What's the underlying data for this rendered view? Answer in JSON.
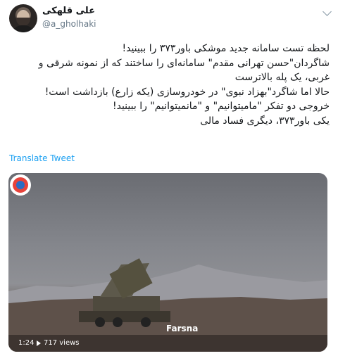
{
  "author": {
    "name": "علی قلهکی",
    "handle": "@a_gholhaki"
  },
  "tweet": {
    "lines": [
      "لحظه تست سامانه جدید موشکی باور۳۷۳ را ببینید!",
      "شاگردان\"حسن تهرانی مقدم\" سامانه‌ای را ساختند که از نمونه شرقی و",
      "غربی، یک پله بالاترست",
      "حالا اما شاگرد\"بهزاد نبوی\" در خودروسازی (یکه زارع) بازداشت است!",
      "خروجی دو تفکر \"ماميتوانيم\" و \"مانميتوانيم\" را ببينيد!",
      "یکی باور۳۷۳، دیگری فساد مالی"
    ],
    "translate_label": "Translate Tweet"
  },
  "media": {
    "watermark": "Farsna",
    "time": "1:24",
    "views": "717 views"
  },
  "icons": {
    "more": "chevron-down-icon",
    "play": "play-icon"
  },
  "colors": {
    "link": "#1da1f2",
    "muted": "#657786"
  }
}
